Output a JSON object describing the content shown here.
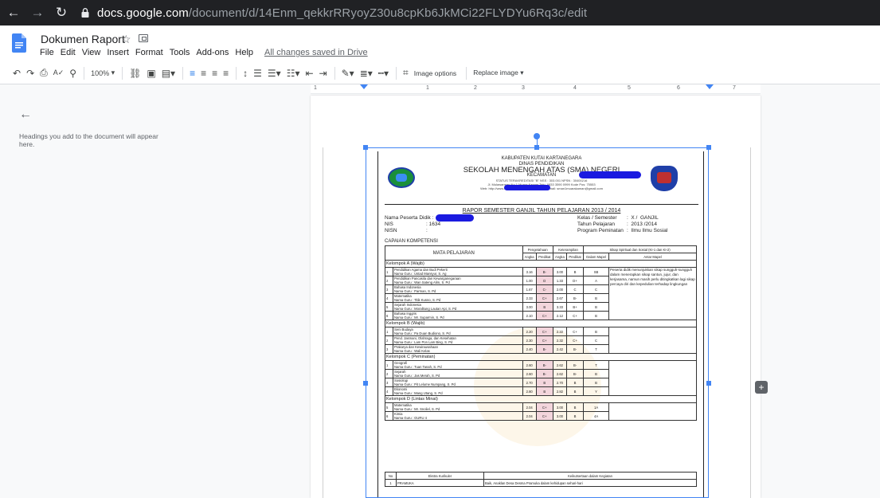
{
  "browser": {
    "url_host": "docs.google.com",
    "url_path": "/document/d/14Enm_qekkrRRyoyZ30u8cpKb6JkMCi22FLYDYu6Rq3c/edit"
  },
  "doc": {
    "title": "Dokumen Raport",
    "menu": [
      "File",
      "Edit",
      "View",
      "Insert",
      "Format",
      "Tools",
      "Add-ons",
      "Help"
    ],
    "saved_status": "All changes saved in Drive"
  },
  "toolbar": {
    "zoom": "100%",
    "image_options": "Image options",
    "replace_image": "Replace image ▾"
  },
  "ruler": {
    "numbers": [
      "1",
      "1",
      "2",
      "3",
      "4",
      "5",
      "6",
      "7"
    ]
  },
  "outline": {
    "hint": "Headings you add to the document will appear here."
  },
  "report": {
    "header": {
      "line1": "KABUPATEN KUTAI KARTANEGARA",
      "line2": "DINAS PENDIDIKAN",
      "line3": "SEKOLAH MENENGAH ATAS (SMA) NEGERI",
      "line4": "KECAMATAN",
      "line5": "STATUS TERAKREDITASI \"B\"   NSS :            303.001    NPSN : 30400216",
      "line6": "Jl. Mulawarman No.1 Muara Kaman     Telp. 0833 3590 0999  Kode Pos: 75553",
      "line7": "Web: http://www.smanegeri1muarakaman.com Email: sman1muarakaman@gmail.com"
    },
    "title": "RAPOR SEMESTER GANJIL TAHUN PELAJARAN 2013 / 2014",
    "student": {
      "name_label": "Nama Peserta Didik :",
      "nis_label": "NIS",
      "nis_value": ": 1634",
      "nisn_label": "NISN",
      "nisn_value": ":",
      "class_label": "Kelas / Semester",
      "class_value": ":  X /  GANJIL",
      "year_label": "Tahun Pelajaran",
      "year_value": ":  2013 /2014",
      "program_label": "Program Peminatan",
      "program_value": ":  Ilmu Ilmu Sosial"
    },
    "capaian": "CAPAIAN KOMPETENSI",
    "table_headers": {
      "mapel": "MATA PELAJARAN",
      "pengetahuan": "Pengetahuan",
      "keterampilan": "Keterampilan",
      "sikap_spiritual": "Sikap Spiritual dan Sosial (KI-1 dan KI-2)",
      "angka": "Angka",
      "predikat": "Predikat",
      "dalam_mapel": "Dalam Mapel",
      "antar_mapel": "Antar Mapel"
    },
    "groups": [
      {
        "name": "Kelompok A (Wajib)",
        "rows": [
          {
            "no": "1",
            "subject": "Pendidikan Agama dan Budi Pekerti",
            "teacher": "Nama Guru : Ustad Mansyur, S. Ag",
            "p_angka": "3.16",
            "p_pred": "B-",
            "k_angka": "3.00",
            "k_pred": "B",
            "sikap": "SB"
          },
          {
            "no": "2",
            "subject": "Pendidikan Pancasila dan Kewarganegaraan",
            "teacher": "Nama Guru : Wan Sateng Alim, S. Pd",
            "p_angka": "1.00",
            "p_pred": "D",
            "k_angka": "1.33",
            "k_pred": "D+",
            "sikap": "A"
          },
          {
            "no": "3",
            "subject": "Bahasa Indonesia",
            "teacher": "Nama Guru : Parman, S. Pd",
            "p_angka": "1.67",
            "p_pred": "C-",
            "k_angka": "2.00",
            "k_pred": "C",
            "sikap": "C"
          },
          {
            "no": "4",
            "subject": "Matematika",
            "teacher": "Nama Guru : Titik Kusno, S. Pd",
            "p_angka": "2.33",
            "p_pred": "C+",
            "k_angka": "2.67",
            "k_pred": "B-",
            "sikap": "B"
          },
          {
            "no": "5",
            "subject": "Sejarah Indonesia",
            "teacher": "Nama Guru : Moralitung Lautan Api, S. Pd",
            "p_angka": "3.00",
            "p_pred": "B",
            "k_angka": "3.33",
            "k_pred": "B+",
            "sikap": "B"
          },
          {
            "no": "6",
            "subject": "Bahasa Inggris",
            "teacher": "Nama Guru : Mr. Suparmin, S. Pd",
            "p_angka": "2.10",
            "p_pred": "C+",
            "k_angka": "2.12",
            "k_pred": "C+",
            "sikap": "B"
          }
        ]
      },
      {
        "name": "Kelompok B (Wajib)",
        "rows": [
          {
            "no": "1",
            "subject": "Seni Budaya",
            "teacher": "Nama Guru : Pa Duan Budiono, S. Pd",
            "p_angka": "2.20",
            "p_pred": "C+",
            "k_angka": "2.22",
            "k_pred": "C+",
            "sikap": "B"
          },
          {
            "no": "2",
            "subject": "Pend. Jasmani, Olahraga, dan Kesehatan",
            "teacher": "Nama Guru : Lam Pon Lam Bing, S. Pd",
            "p_angka": "2.30",
            "p_pred": "C+",
            "k_angka": "2.32",
            "k_pred": "C+",
            "sikap": "C"
          },
          {
            "no": "3",
            "subject": "Prakarya dan Kewirausahaan",
            "teacher": "Nama Guru : Wali Kelas",
            "p_angka": "2.40",
            "p_pred": "B-",
            "k_angka": "2.42",
            "k_pred": "B-",
            "sikap": "T"
          }
        ]
      },
      {
        "name": "Kelompok C (Peminatan)",
        "rows": [
          {
            "no": "1",
            "subject": "Geografi",
            "teacher": "Nama Guru : Tuan Tanah, S. Pd",
            "p_angka": "2.60",
            "p_pred": "B-",
            "k_angka": "2.62",
            "k_pred": "B-",
            "sikap": "T"
          },
          {
            "no": "2",
            "subject": "Sejarah",
            "teacher": "Nama Guru : Jas Merah, S. Pd",
            "p_angka": "2.60",
            "p_pred": "B-",
            "k_angka": "2.62",
            "k_pred": "B-",
            "sikap": "B"
          },
          {
            "no": "3",
            "subject": "Sosiologi",
            "teacher": "Nama Guru : Pit Lelume Numpang, S. Pd",
            "p_angka": "2.70",
            "p_pred": "B",
            "k_angka": "2.70",
            "k_pred": "B",
            "sikap": "B"
          },
          {
            "no": "4",
            "subject": "Ekonomi",
            "teacher": "Nama Guru : Mang Utang, S. Pd",
            "p_angka": "2.80",
            "p_pred": "B",
            "k_angka": "2.82",
            "k_pred": "B",
            "sikap": "Y"
          }
        ]
      },
      {
        "name": "Kelompok D (Lintas Minat)",
        "rows": [
          {
            "no": "5",
            "subject": "Matematika",
            "teacher": "Nama Guru : Mr. Snoliel, S. Pd",
            "p_angka": "2.04",
            "p_pred": "C+",
            "k_angka": "3.00",
            "k_pred": "B",
            "sikap": "1A"
          },
          {
            "no": "6",
            "subject": "Kimia",
            "teacher": "Nama Guru : GURU 4",
            "p_angka": "2.04",
            "p_pred": "C+",
            "k_angka": "3.00",
            "k_pred": "B",
            "sikap": "4A"
          }
        ]
      }
    ],
    "sikap_desc": "Peserta didik menunjukkan sikap sungguh-sungguh dalam menerapkan sikap santun, jujur, dan kerjasama, namun masih perlu ditingkatkan lagi sikap percaya diri dan kepedulian terhadap lingkungan",
    "extra": {
      "no": "No",
      "header": "Ekstra Kurikuler",
      "activity_header": "Keikutsertaan dalam Kegiatan",
      "rows": [
        {
          "no": "1",
          "name": "PRAMUKA",
          "desc": "Baik, Anaklan Desa Desma Pramuka dalam kehidupan sehari-hari"
        }
      ]
    }
  }
}
